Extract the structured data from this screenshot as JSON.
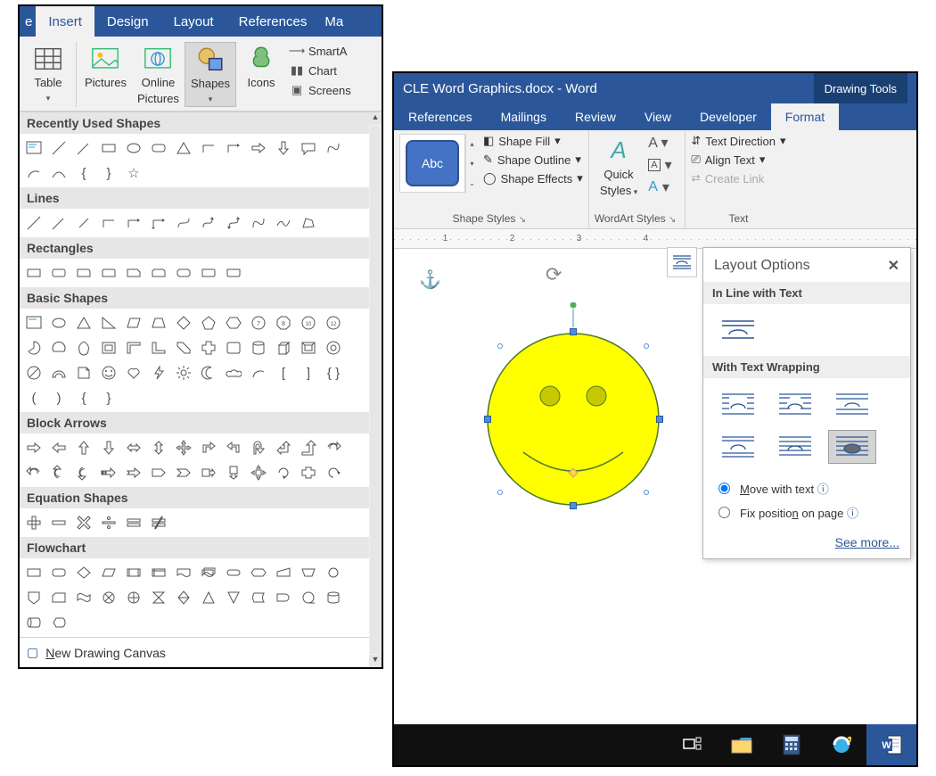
{
  "left": {
    "tabs": [
      "e",
      "Insert",
      "Design",
      "Layout",
      "References",
      "Ma"
    ],
    "activeTab": "Insert",
    "ribbon": {
      "table": "Table",
      "pictures": "Pictures",
      "onlinePictures1": "Online",
      "onlinePictures2": "Pictures",
      "shapes": "Shapes",
      "icons": "Icons",
      "smartArt": "SmartA",
      "chart": "Chart",
      "screenshot": "Screens"
    },
    "gallery": {
      "recent": "Recently Used Shapes",
      "lines": "Lines",
      "rectangles": "Rectangles",
      "basic": "Basic Shapes",
      "block": "Block Arrows",
      "equation": "Equation Shapes",
      "flow": "Flowchart",
      "newCanvas": "New Drawing Canvas"
    }
  },
  "right": {
    "title": "CLE Word Graphics.docx  -  Word",
    "drawingTools": "Drawing Tools",
    "tabs": [
      "References",
      "Mailings",
      "Review",
      "View",
      "Developer",
      "Format"
    ],
    "activeTab": "Format",
    "ribbon": {
      "abc": "Abc",
      "shapeFill": "Shape Fill",
      "shapeOutline": "Shape Outline",
      "shapeEffects": "Shape Effects",
      "groupStyles": "Shape Styles",
      "quickStyles1": "Quick",
      "quickStyles2": "Styles",
      "groupWordArt": "WordArt Styles",
      "textDirection": "Text Direction",
      "alignText": "Align Text",
      "createLink": "Create Link",
      "groupText": "Text"
    },
    "ruler": [
      "1",
      "2",
      "3",
      "4"
    ],
    "layout": {
      "title": "Layout Options",
      "inLine": "In Line with Text",
      "withWrap": "With Text Wrapping",
      "radioMoveUnderline": "M",
      "radioMoveRest": "ove with text",
      "radioFix1": "Fix positio",
      "radioFixU": "n",
      "radioFix2": " on page",
      "seeMore": "See more..."
    },
    "taskbar": {
      "taskview": "task-view",
      "explorer": "file-explorer",
      "calc": "calculator",
      "ie": "internet-explorer",
      "word": "word"
    }
  }
}
